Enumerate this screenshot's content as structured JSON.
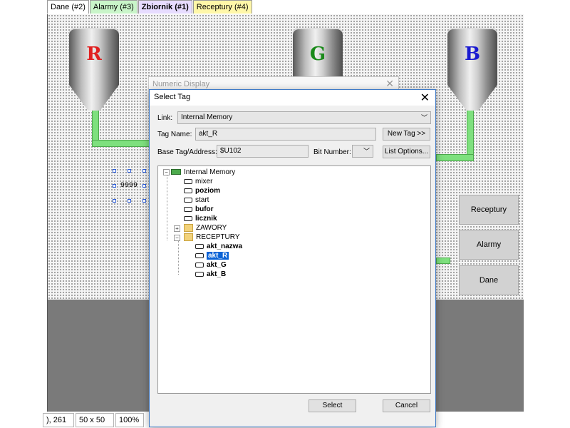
{
  "tabs": [
    {
      "label": "Dane (#2)",
      "color": "#ffffff"
    },
    {
      "label": "Alarmy (#3)",
      "color": "#c9f5c9"
    },
    {
      "label": "Zbiornik (#1)",
      "color": "#e7dcff"
    },
    {
      "label": "Receptury (#4)",
      "color": "#fff7a8"
    }
  ],
  "tanks": [
    {
      "letter": "R",
      "color": "#e02020"
    },
    {
      "letter": "G",
      "color": "#1a8a1a"
    },
    {
      "letter": "B",
      "color": "#1a1ad0"
    }
  ],
  "canvas": {
    "numeric_placeholder": "9999",
    "side_buttons": [
      "Receptury",
      "Alarmy",
      "Dane"
    ]
  },
  "status_bar": {
    "coords": "), 261",
    "size": "50 x 50",
    "zoom": "100%"
  },
  "background_dialog": {
    "title": "Numeric Display"
  },
  "dialog": {
    "title": "Select Tag",
    "link_label": "Link:",
    "link_value": "Internal Memory",
    "tag_name_label": "Tag Name:",
    "tag_name_value": "akt_R",
    "new_tag_button": "New Tag >>",
    "base_tag_label": "Base Tag/Address:",
    "base_tag_value": "$U102",
    "bit_number_label": "Bit Number:",
    "list_options_button": "List Options...",
    "select_button": "Select",
    "cancel_button": "Cancel",
    "tree": {
      "root": "Internal Memory",
      "items": [
        "mixer",
        "poziom",
        "start",
        "bufor",
        "licznik"
      ],
      "folders": [
        {
          "label": "ZAWORY",
          "expanded": false
        },
        {
          "label": "RECEPTURY",
          "expanded": true,
          "children": [
            "akt_nazwa",
            "akt_R",
            "akt_G",
            "akt_B"
          ]
        }
      ],
      "selected": "akt_R"
    }
  }
}
